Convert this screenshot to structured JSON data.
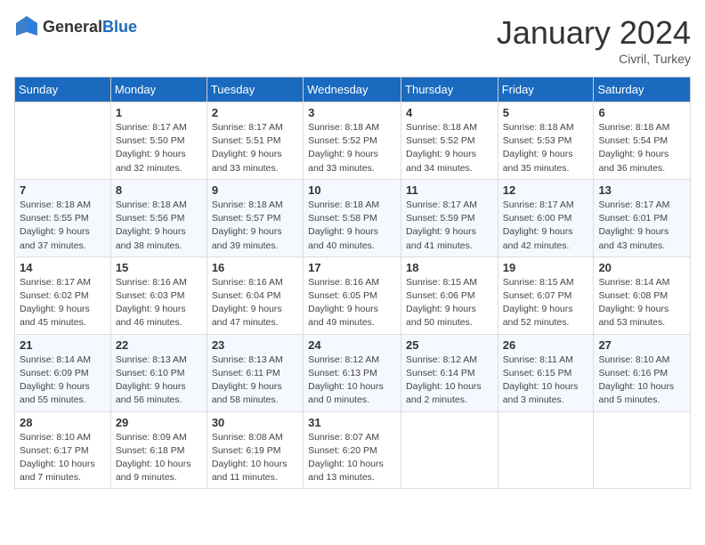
{
  "header": {
    "logo_general": "General",
    "logo_blue": "Blue",
    "month_title": "January 2024",
    "location": "Civril, Turkey"
  },
  "weekdays": [
    "Sunday",
    "Monday",
    "Tuesday",
    "Wednesday",
    "Thursday",
    "Friday",
    "Saturday"
  ],
  "weeks": [
    [
      {
        "day": "",
        "sunrise": "",
        "sunset": "",
        "daylight": ""
      },
      {
        "day": "1",
        "sunrise": "Sunrise: 8:17 AM",
        "sunset": "Sunset: 5:50 PM",
        "daylight": "Daylight: 9 hours and 32 minutes."
      },
      {
        "day": "2",
        "sunrise": "Sunrise: 8:17 AM",
        "sunset": "Sunset: 5:51 PM",
        "daylight": "Daylight: 9 hours and 33 minutes."
      },
      {
        "day": "3",
        "sunrise": "Sunrise: 8:18 AM",
        "sunset": "Sunset: 5:52 PM",
        "daylight": "Daylight: 9 hours and 33 minutes."
      },
      {
        "day": "4",
        "sunrise": "Sunrise: 8:18 AM",
        "sunset": "Sunset: 5:52 PM",
        "daylight": "Daylight: 9 hours and 34 minutes."
      },
      {
        "day": "5",
        "sunrise": "Sunrise: 8:18 AM",
        "sunset": "Sunset: 5:53 PM",
        "daylight": "Daylight: 9 hours and 35 minutes."
      },
      {
        "day": "6",
        "sunrise": "Sunrise: 8:18 AM",
        "sunset": "Sunset: 5:54 PM",
        "daylight": "Daylight: 9 hours and 36 minutes."
      }
    ],
    [
      {
        "day": "7",
        "sunrise": "Sunrise: 8:18 AM",
        "sunset": "Sunset: 5:55 PM",
        "daylight": "Daylight: 9 hours and 37 minutes."
      },
      {
        "day": "8",
        "sunrise": "Sunrise: 8:18 AM",
        "sunset": "Sunset: 5:56 PM",
        "daylight": "Daylight: 9 hours and 38 minutes."
      },
      {
        "day": "9",
        "sunrise": "Sunrise: 8:18 AM",
        "sunset": "Sunset: 5:57 PM",
        "daylight": "Daylight: 9 hours and 39 minutes."
      },
      {
        "day": "10",
        "sunrise": "Sunrise: 8:18 AM",
        "sunset": "Sunset: 5:58 PM",
        "daylight": "Daylight: 9 hours and 40 minutes."
      },
      {
        "day": "11",
        "sunrise": "Sunrise: 8:17 AM",
        "sunset": "Sunset: 5:59 PM",
        "daylight": "Daylight: 9 hours and 41 minutes."
      },
      {
        "day": "12",
        "sunrise": "Sunrise: 8:17 AM",
        "sunset": "Sunset: 6:00 PM",
        "daylight": "Daylight: 9 hours and 42 minutes."
      },
      {
        "day": "13",
        "sunrise": "Sunrise: 8:17 AM",
        "sunset": "Sunset: 6:01 PM",
        "daylight": "Daylight: 9 hours and 43 minutes."
      }
    ],
    [
      {
        "day": "14",
        "sunrise": "Sunrise: 8:17 AM",
        "sunset": "Sunset: 6:02 PM",
        "daylight": "Daylight: 9 hours and 45 minutes."
      },
      {
        "day": "15",
        "sunrise": "Sunrise: 8:16 AM",
        "sunset": "Sunset: 6:03 PM",
        "daylight": "Daylight: 9 hours and 46 minutes."
      },
      {
        "day": "16",
        "sunrise": "Sunrise: 8:16 AM",
        "sunset": "Sunset: 6:04 PM",
        "daylight": "Daylight: 9 hours and 47 minutes."
      },
      {
        "day": "17",
        "sunrise": "Sunrise: 8:16 AM",
        "sunset": "Sunset: 6:05 PM",
        "daylight": "Daylight: 9 hours and 49 minutes."
      },
      {
        "day": "18",
        "sunrise": "Sunrise: 8:15 AM",
        "sunset": "Sunset: 6:06 PM",
        "daylight": "Daylight: 9 hours and 50 minutes."
      },
      {
        "day": "19",
        "sunrise": "Sunrise: 8:15 AM",
        "sunset": "Sunset: 6:07 PM",
        "daylight": "Daylight: 9 hours and 52 minutes."
      },
      {
        "day": "20",
        "sunrise": "Sunrise: 8:14 AM",
        "sunset": "Sunset: 6:08 PM",
        "daylight": "Daylight: 9 hours and 53 minutes."
      }
    ],
    [
      {
        "day": "21",
        "sunrise": "Sunrise: 8:14 AM",
        "sunset": "Sunset: 6:09 PM",
        "daylight": "Daylight: 9 hours and 55 minutes."
      },
      {
        "day": "22",
        "sunrise": "Sunrise: 8:13 AM",
        "sunset": "Sunset: 6:10 PM",
        "daylight": "Daylight: 9 hours and 56 minutes."
      },
      {
        "day": "23",
        "sunrise": "Sunrise: 8:13 AM",
        "sunset": "Sunset: 6:11 PM",
        "daylight": "Daylight: 9 hours and 58 minutes."
      },
      {
        "day": "24",
        "sunrise": "Sunrise: 8:12 AM",
        "sunset": "Sunset: 6:13 PM",
        "daylight": "Daylight: 10 hours and 0 minutes."
      },
      {
        "day": "25",
        "sunrise": "Sunrise: 8:12 AM",
        "sunset": "Sunset: 6:14 PM",
        "daylight": "Daylight: 10 hours and 2 minutes."
      },
      {
        "day": "26",
        "sunrise": "Sunrise: 8:11 AM",
        "sunset": "Sunset: 6:15 PM",
        "daylight": "Daylight: 10 hours and 3 minutes."
      },
      {
        "day": "27",
        "sunrise": "Sunrise: 8:10 AM",
        "sunset": "Sunset: 6:16 PM",
        "daylight": "Daylight: 10 hours and 5 minutes."
      }
    ],
    [
      {
        "day": "28",
        "sunrise": "Sunrise: 8:10 AM",
        "sunset": "Sunset: 6:17 PM",
        "daylight": "Daylight: 10 hours and 7 minutes."
      },
      {
        "day": "29",
        "sunrise": "Sunrise: 8:09 AM",
        "sunset": "Sunset: 6:18 PM",
        "daylight": "Daylight: 10 hours and 9 minutes."
      },
      {
        "day": "30",
        "sunrise": "Sunrise: 8:08 AM",
        "sunset": "Sunset: 6:19 PM",
        "daylight": "Daylight: 10 hours and 11 minutes."
      },
      {
        "day": "31",
        "sunrise": "Sunrise: 8:07 AM",
        "sunset": "Sunset: 6:20 PM",
        "daylight": "Daylight: 10 hours and 13 minutes."
      },
      {
        "day": "",
        "sunrise": "",
        "sunset": "",
        "daylight": ""
      },
      {
        "day": "",
        "sunrise": "",
        "sunset": "",
        "daylight": ""
      },
      {
        "day": "",
        "sunrise": "",
        "sunset": "",
        "daylight": ""
      }
    ]
  ]
}
